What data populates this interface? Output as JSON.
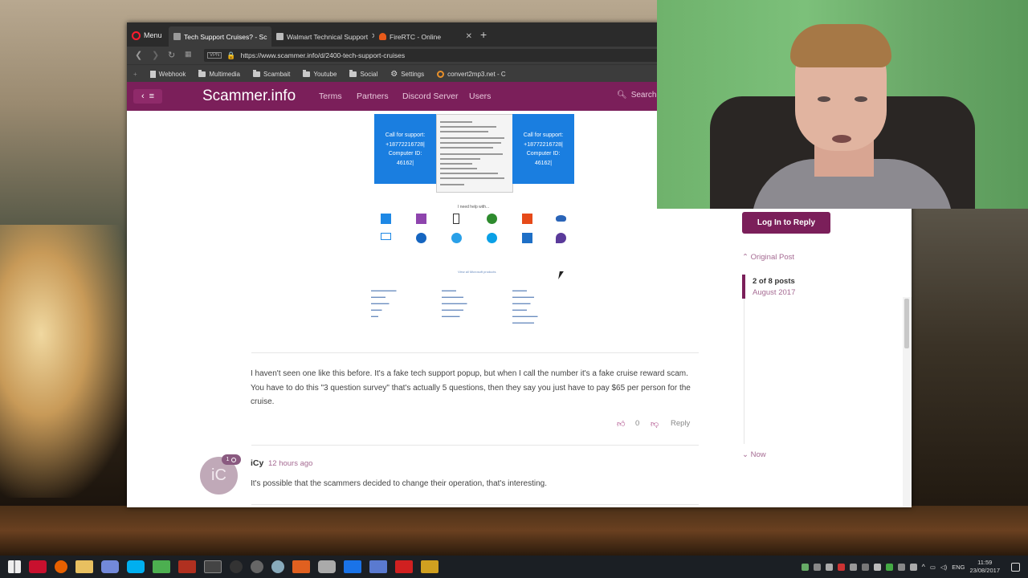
{
  "browser": {
    "menu_label": "Menu",
    "tabs": [
      {
        "label": "Tech Support Cruises? - Sc",
        "active": true
      },
      {
        "label": "Walmart Technical Support",
        "active": false
      },
      {
        "label": "FireRTC - Online",
        "active": false
      }
    ],
    "url": "https://www.scammer.info/d/2400-tech-support-cruises",
    "bookmarks": [
      "Webhook",
      "Multimedia",
      "Scambait",
      "Youtube",
      "Social",
      "Settings",
      "convert2mp3.net - C"
    ]
  },
  "site": {
    "brand": "Scammer.info",
    "nav": [
      "Terms",
      "Partners",
      "Discord Server",
      "Users"
    ],
    "search_label": "Search",
    "accent": "#7b1f5a"
  },
  "embedded_image": {
    "popup_lines": [
      "Call for support:",
      "+18772216728|",
      "Computer ID:",
      "46162|"
    ],
    "heading": "I need help with..."
  },
  "post": {
    "text": "I haven't seen one like this before. It's a fake tech support popup, but when I call the number it's a fake cruise reward scam. You have to do this \"3 question survey\" that's actually 5 questions, then they say you just have to pay $65 per person for the cruise.",
    "likes": "0",
    "reply_label": "Reply"
  },
  "reply": {
    "avatar_initials": "iC",
    "badge_count": "1",
    "username": "iCy",
    "time": "12 hours ago",
    "text": "It's possible that the scammers decided to change their operation, that's interesting."
  },
  "sidebar": {
    "login_label": "Log In to Reply",
    "original_post": "Original Post",
    "position": "2 of 8 posts",
    "position_date": "August 2017",
    "now": "Now"
  },
  "taskbar": {
    "lang": "ENG",
    "time": "11:59",
    "date": "23/08/2017"
  }
}
